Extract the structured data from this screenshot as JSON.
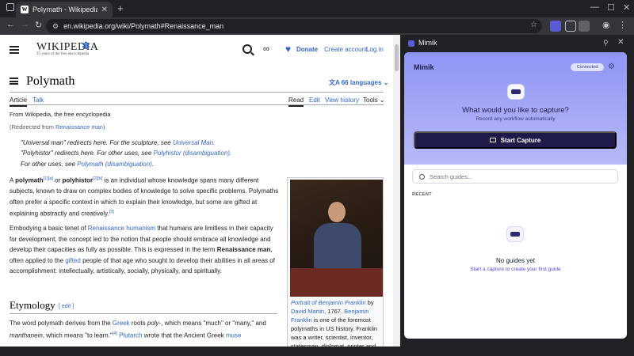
{
  "browser": {
    "tab_title": "Polymath - Wikipedia",
    "favicon_letter": "W",
    "url": "en.wikipedia.org/wiki/Polymath#Renaissance_man"
  },
  "wiki": {
    "logo_word": "WIKIPEDIA",
    "logo_tagline": "25 years of the free encyclopedia",
    "donate": "Donate",
    "create_account": "Create account",
    "login": "Log in",
    "title": "Polymath",
    "languages": "66 languages",
    "tabs": [
      "Article",
      "Talk"
    ],
    "actions": [
      "Read",
      "Edit",
      "View history",
      "Tools"
    ],
    "from": "From Wikipedia, the free encyclopedia",
    "redirected_prefix": "(Redirected from ",
    "redirected_link": "Renaissance man",
    "redirected_suffix": ")",
    "hatnotes": [
      {
        "pre": "\"Universal man\" redirects here. For the sculpture, see ",
        "link": "Universal Man.",
        "post": ""
      },
      {
        "pre": "\"Polyhistor\" redirects here. For other uses, see ",
        "link": "Polyhistor (disambiguation).",
        "post": ""
      },
      {
        "pre": "For other uses, see ",
        "link": "Polymath (disambiguation)",
        "post": "."
      }
    ],
    "para1": {
      "a": "A ",
      "b": "polymath",
      "s1": "[1][a]",
      "c": " or ",
      "d": "polyhistor",
      "s2": "[2][b]",
      "e": " is an individual whose knowledge spans many different subjects, known to draw on complex bodies of knowledge to solve specific problems. Polymaths often prefer a specific context in which to explain their knowledge, but some are gifted at explaining abstractly and creatively.",
      "s3": "[3]"
    },
    "para2": {
      "a": "Embodying a basic tenet of ",
      "link1": "Renaissance humanism",
      "b": " that humans are limitless in their capacity for development, the concept led to the notion that people should embrace all knowledge and develop their capacities as fully as possible. This is expressed in the term ",
      "bold": "Renaissance man",
      "c": ", often applied to the ",
      "link2": "gifted",
      "d": " people of that age who sought to develop their abilities in all areas of accomplishment: intellectually, artistically, socially, physically, and spiritually."
    },
    "section": "Etymology",
    "section_edit": "[ edit ]",
    "para3": {
      "a": "The word polymath derives from the ",
      "link1": "Greek",
      "b": " roots ",
      "i1": "poly-",
      "c": ", which means \"much\" or \"many,\" and ",
      "i2": "manthanein",
      "d": ", which means \"to learn.\"",
      "s1": "[4]",
      "e": " ",
      "link2": "Plutarch",
      "f": " wrote that the Ancient Greek ",
      "link3": "muse"
    },
    "caption": {
      "link1": "Portrait of Benjamin Franklin",
      "a": " by ",
      "link2": "David Martin",
      "b": ", 1767. ",
      "link3": "Benjamin Franklin",
      "c": " is one of the foremost polymaths in US history. Franklin was a writer, scientist, inventor, statesman, diplomat, printer and"
    }
  },
  "mimik": {
    "panel_title": "Mimik",
    "brand": "Mimik",
    "status": "Connected",
    "question": "What would you like to capture?",
    "subtitle": "Record any workflow automatically",
    "capture_button": "Start Capture",
    "search_placeholder": "Search guides...",
    "recent_label": "RECENT",
    "empty_title": "No guides yet",
    "empty_hint": "Start a capture to create your first guide"
  }
}
